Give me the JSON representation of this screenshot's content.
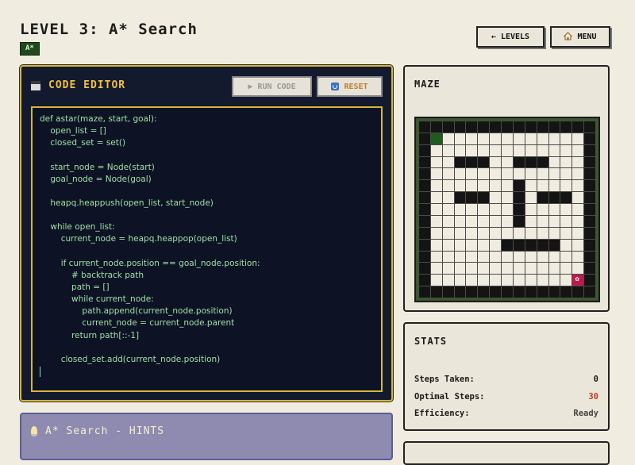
{
  "header": {
    "title": "LEVEL 3: A* Search",
    "badge": "A*",
    "levels_button": "← LEVELS",
    "menu_button": "MENU",
    "menu_icon": "house-icon"
  },
  "editor": {
    "title": "CODE EDITOR",
    "run_button": "▶ RUN CODE",
    "reset_button": "RESET",
    "code_lines": [
      "def astar(maze, start, goal):",
      "    open_list = []",
      "    closed_set = set()",
      "",
      "    start_node = Node(start)",
      "    goal_node = Node(goal)",
      "",
      "    heapq.heappush(open_list, start_node)",
      "",
      "    while open_list:",
      "        current_node = heapq.heappop(open_list)",
      "",
      "        if current_node.position == goal_node.position:",
      "            # backtrack path",
      "            path = []",
      "            while current_node:",
      "                path.append(current_node.position)",
      "                current_node = current_node.parent",
      "            return path[::-1]",
      "",
      "        closed_set.add(current_node.position)",
      ""
    ]
  },
  "hints": {
    "title": "A* Search - HINTS"
  },
  "maze": {
    "title": "MAZE",
    "size": 15,
    "start": [
      1,
      1
    ],
    "goal": [
      13,
      13
    ],
    "rows": [
      "###############",
      "#S............#",
      "#.............#",
      "#..###..###...#",
      "#.............#",
      "#.......#.....#",
      "#..###..#.###.#",
      "#.......#.....#",
      "#.......#.....#",
      "#.............#",
      "#......#####..#",
      "#.............#",
      "#.............#",
      "#............G#",
      "###############"
    ],
    "colors": {
      "wall": "#141414",
      "open": "#f1ece0",
      "start": "#1f5a1f",
      "goal": "#c0184a",
      "border": "#3d5530"
    }
  },
  "stats": {
    "title": "STATS",
    "steps_label": "Steps Taken:",
    "steps_value": "0",
    "optimal_label": "Optimal Steps:",
    "optimal_value": "30",
    "efficiency_label": "Efficiency:",
    "efficiency_value": "Ready"
  }
}
